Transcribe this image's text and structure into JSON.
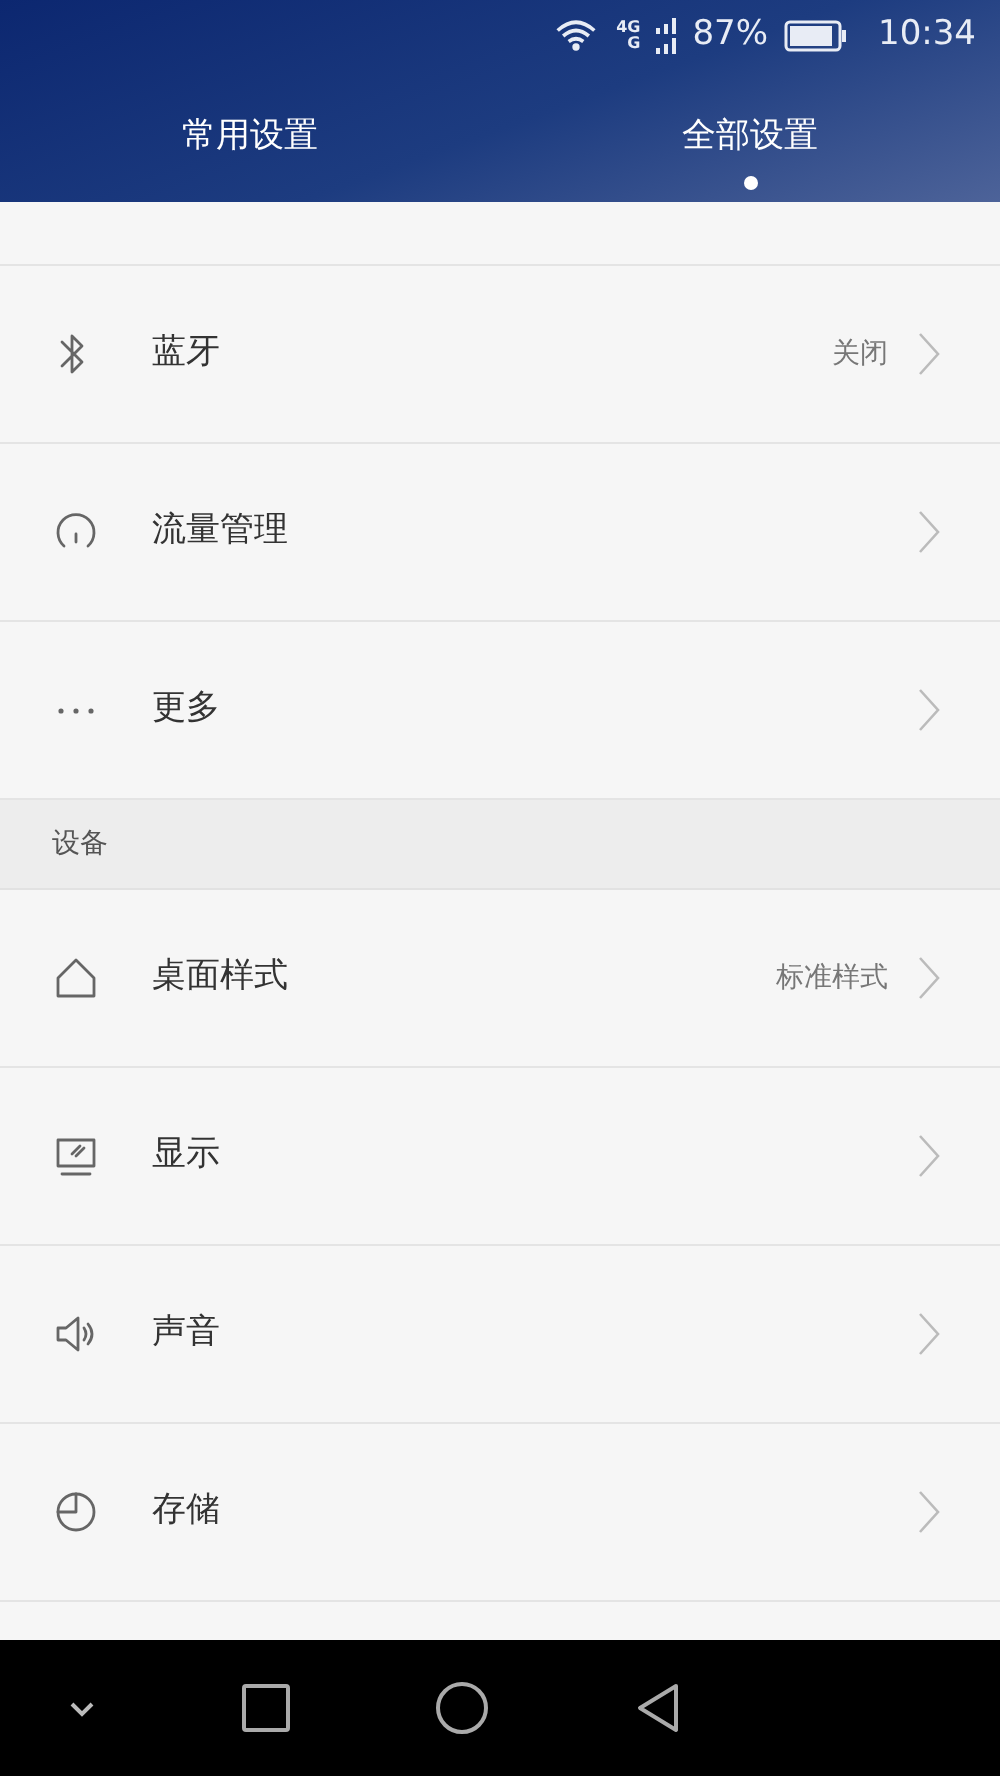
{
  "status_bar": {
    "network_1": "4G",
    "network_2": "G",
    "battery": "87%",
    "time": "10:34"
  },
  "tabs": [
    {
      "label": "常用设置",
      "selected": false
    },
    {
      "label": "全部设置",
      "selected": true
    }
  ],
  "sections": [
    {
      "items": [
        {
          "label": "蓝牙",
          "value": "关闭"
        },
        {
          "label": "流量管理"
        },
        {
          "label": "更多"
        }
      ]
    },
    {
      "header": "设备",
      "items": [
        {
          "label": "桌面样式",
          "value": "标准样式"
        },
        {
          "label": "显示"
        },
        {
          "label": "声音"
        },
        {
          "label": "存储"
        }
      ]
    }
  ]
}
